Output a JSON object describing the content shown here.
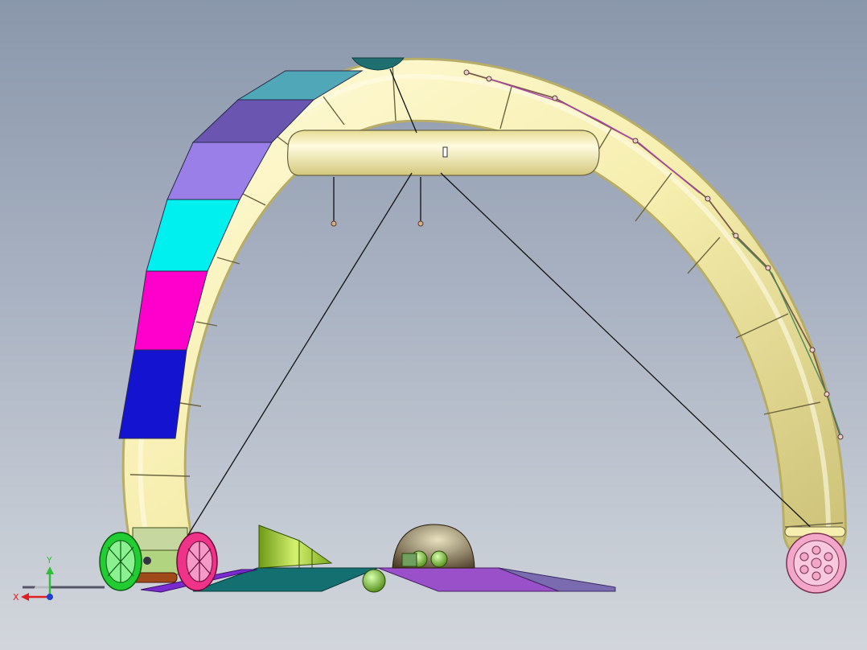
{
  "view": {
    "title": "",
    "background_top": "#8a97ab",
    "background_bottom": "#d2d6dc"
  },
  "triad": {
    "y_label": "Y",
    "x_label": "X",
    "y_color": "#2fbf3a",
    "x_color": "#e02020"
  },
  "model": {
    "tube_color": "#f6eeae",
    "tube_shade": "#d8cf86",
    "panel_colors": [
      "#1414d0",
      "#ff00cc",
      "#00f0f0",
      "#9b7fe8",
      "#6a55b0",
      "#4fa7b8"
    ],
    "wheel_colors": [
      "#22cc33",
      "#ee3388",
      "#f2a7c8"
    ],
    "base_colors": [
      "#147070",
      "#9a50c8",
      "#7aa81a"
    ]
  }
}
